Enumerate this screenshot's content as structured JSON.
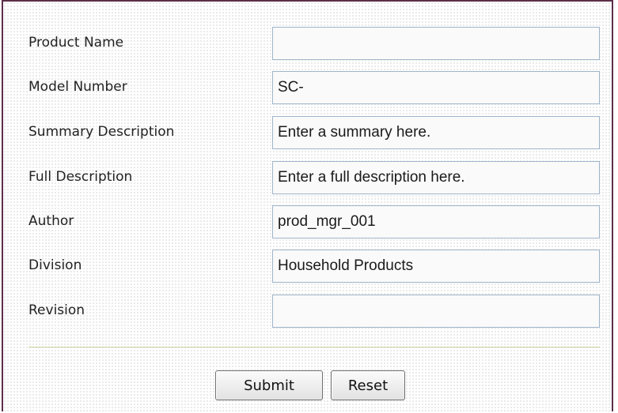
{
  "form": {
    "fields": [
      {
        "label": "Product Name",
        "value": ""
      },
      {
        "label": "Model Number",
        "value": "SC-"
      },
      {
        "label": "Summary Description",
        "value": "Enter a summary here."
      },
      {
        "label": "Full Description",
        "value": "Enter a full description here."
      },
      {
        "label": "Author",
        "value": "prod_mgr_001"
      },
      {
        "label": "Division",
        "value": "Household Products"
      },
      {
        "label": "Revision",
        "value": ""
      }
    ],
    "buttons": {
      "submit_label": "Submit",
      "reset_label": "Reset"
    }
  },
  "colors": {
    "frame_border": "#5c2f4a",
    "field_border": "#9fb4c9",
    "divider": "#c8cf9a"
  }
}
